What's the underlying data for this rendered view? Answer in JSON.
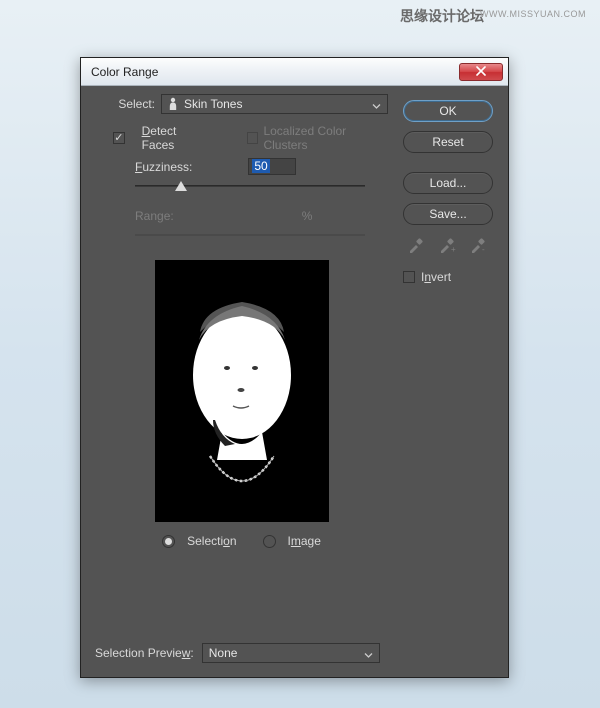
{
  "watermark": {
    "zh": "思缘设计论坛",
    "url": "WWW.MISSYUAN.COM"
  },
  "dialog": {
    "title": "Color Range",
    "select": {
      "label": "Select:",
      "value": "Skin Tones"
    },
    "detect_faces": {
      "label_pre": "D",
      "label_post": "etect Faces",
      "checked": true
    },
    "localized": {
      "label": "Localized Color Clusters",
      "checked": false
    },
    "fuzziness": {
      "label_pre": "F",
      "label_post": "uzziness:",
      "value": "50"
    },
    "range": {
      "label_pre": "R",
      "label_post": "ange:",
      "pct": "%"
    },
    "radios": {
      "selection": {
        "pre": "Selecti",
        "ul": "o",
        "post": "n"
      },
      "image": {
        "pre": "I",
        "ul": "m",
        "post": "age"
      }
    },
    "selection_preview": {
      "label_pre": "Selection Previe",
      "label_ul": "w",
      "label_post": ":",
      "value": "None"
    }
  },
  "buttons": {
    "ok": "OK",
    "reset": "Reset",
    "load": "Load...",
    "save": "Save..."
  },
  "invert": {
    "label_pre": "I",
    "label_ul": "n",
    "label_post": "vert",
    "checked": false
  },
  "icons": {
    "person": "person-icon",
    "chevron": "chevron-down-icon",
    "close": "close-icon",
    "eyedropper": "eyedropper-icon"
  }
}
